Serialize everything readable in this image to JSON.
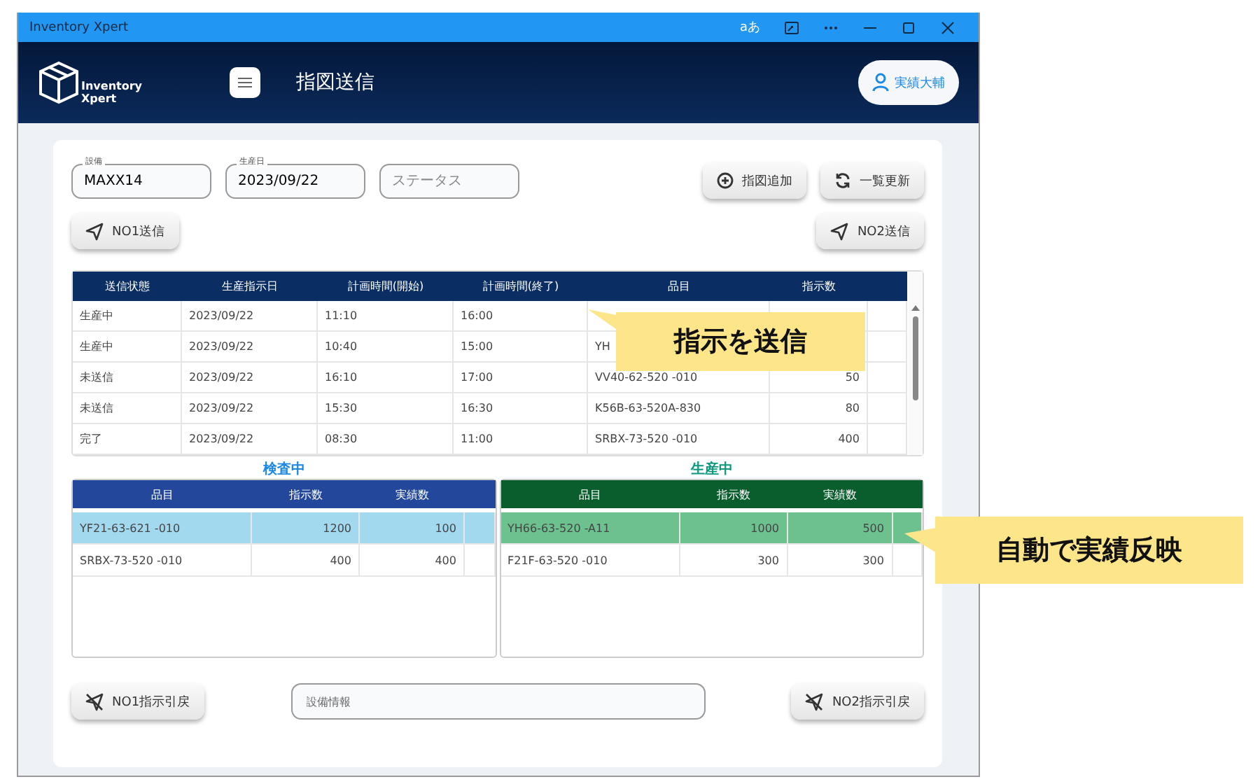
{
  "window": {
    "title": "Inventory Xpert",
    "language_glyph": "aあ"
  },
  "header": {
    "logo_lines": [
      "Inventory",
      "Xpert"
    ],
    "page_title": "指図送信",
    "user": "実績大輔"
  },
  "filters": [
    {
      "label": "設備",
      "value": "MAXX14"
    },
    {
      "label": "生産日",
      "value": "2023/09/22"
    },
    {
      "placeholder": "ステータス"
    }
  ],
  "actions": [
    {
      "kind": "add",
      "label": "指図追加"
    },
    {
      "kind": "refresh",
      "label": "一覧更新"
    }
  ],
  "send_buttons": [
    {
      "label": "NO1送信"
    },
    {
      "label": "NO2送信"
    }
  ],
  "orders": {
    "columns": [
      "送信状態",
      "生産指示日",
      "計画時間(開始)",
      "計画時間(終了)",
      "品目",
      "指示数"
    ],
    "rows": [
      {
        "cells": [
          "生産中",
          "2023/09/22",
          "11:10",
          "16:00"
        ]
      },
      {
        "cells": [
          "生産中",
          "2023/09/22",
          "10:40",
          "15:00",
          "YH"
        ]
      },
      {
        "cells": [
          "未送信",
          "2023/09/22",
          "16:10",
          "17:00",
          "VV40-62-520 -010",
          "50"
        ]
      },
      {
        "cells": [
          "未送信",
          "2023/09/22",
          "15:30",
          "16:30",
          "K56B-63-520A-830",
          "80"
        ]
      },
      {
        "cells": [
          "完了",
          "2023/09/22",
          "08:30",
          "11:00",
          "SRBX-73-520 -010",
          "400"
        ]
      }
    ]
  },
  "lines": [
    {
      "title": "検査中",
      "kind": "inspection",
      "columns": [
        "品目",
        "指示数",
        "実績数"
      ],
      "rows": [
        {
          "cells": [
            "YF21-63-621 -010",
            "1200",
            "100"
          ],
          "selected": true
        },
        {
          "cells": [
            "SRBX-73-520 -010",
            "400",
            "400"
          ],
          "selected": false
        }
      ]
    },
    {
      "title": "生産中",
      "kind": "production",
      "columns": [
        "品目",
        "指示数",
        "実績数"
      ],
      "rows": [
        {
          "cells": [
            "YH66-63-520 -A11",
            "1000",
            "500"
          ],
          "selected": true
        },
        {
          "cells": [
            "F21F-63-520 -010",
            "300",
            "300"
          ],
          "selected": false
        }
      ]
    }
  ],
  "recall_buttons": [
    {
      "label": "NO1指示引戻"
    },
    {
      "label": "NO2指示引戻"
    }
  ],
  "equipment_info": {
    "placeholder": "設備情報"
  },
  "callouts": [
    {
      "kind": "send",
      "text": "指示を送信"
    },
    {
      "kind": "auto",
      "text": "自動で実績反映"
    }
  ]
}
